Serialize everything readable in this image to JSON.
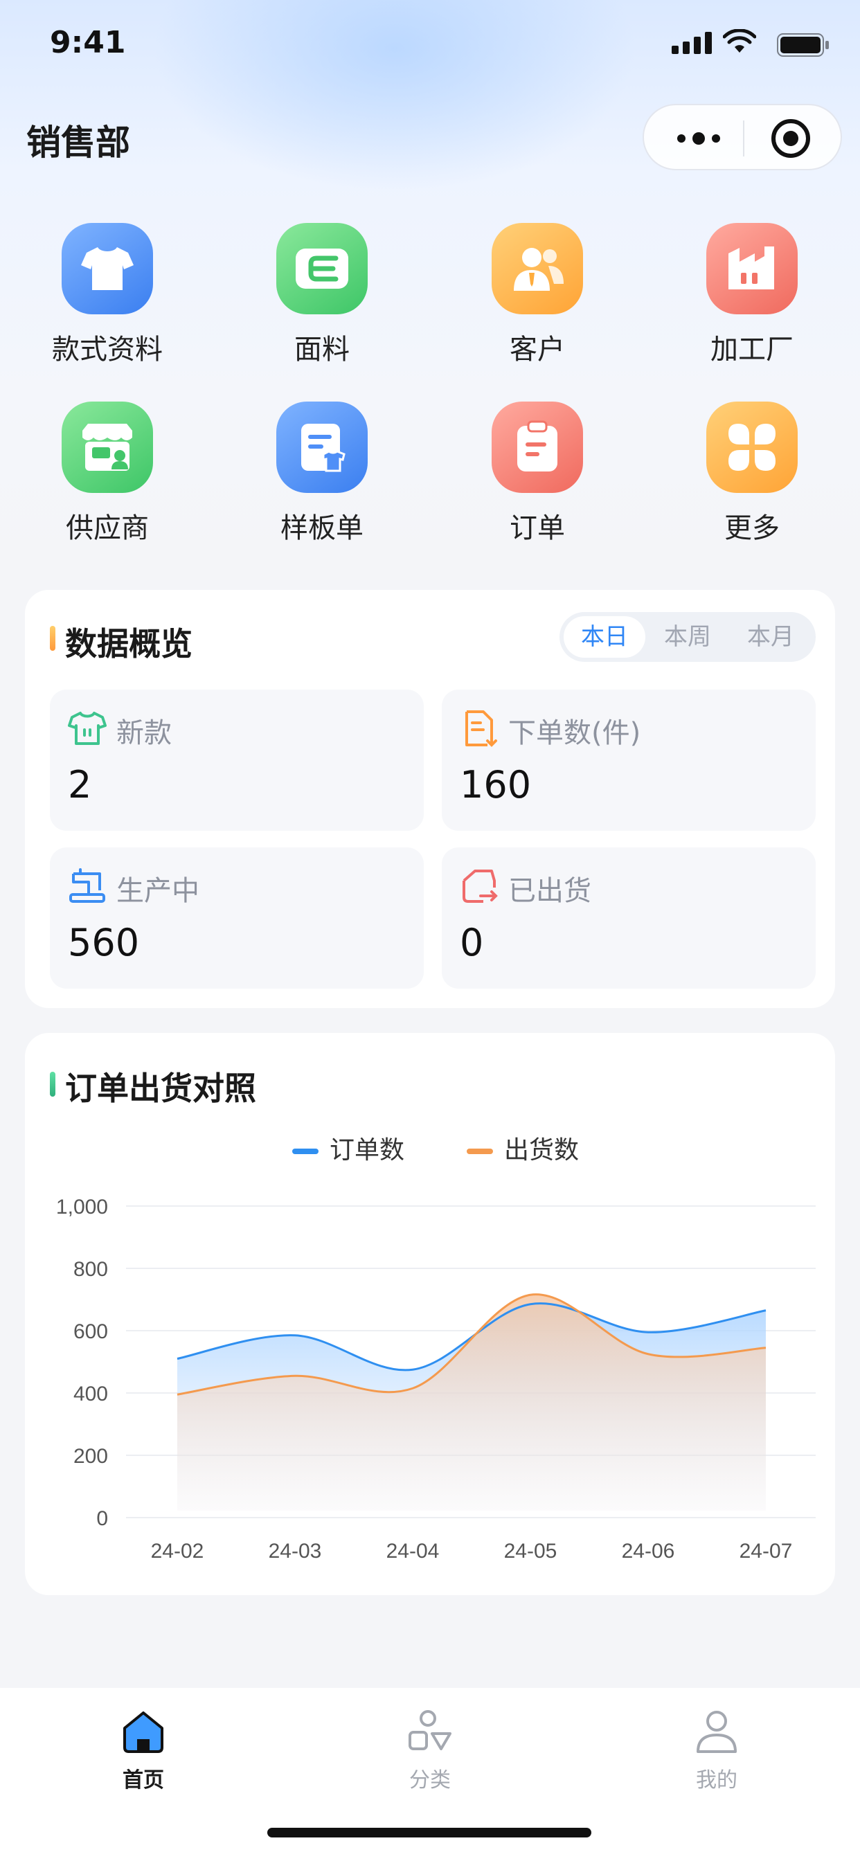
{
  "status_bar": {
    "time": "9:41"
  },
  "header": {
    "title": "销售部"
  },
  "grid": [
    {
      "label": "款式资料",
      "icon": "tshirt-icon",
      "color": "#4f8ff7"
    },
    {
      "label": "面料",
      "icon": "fabric-icon",
      "color": "#4fcf72"
    },
    {
      "label": "客户",
      "icon": "customer-icon",
      "color": "#ffad3d"
    },
    {
      "label": "加工厂",
      "icon": "factory-icon",
      "color": "#f27468"
    },
    {
      "label": "供应商",
      "icon": "supplier-store-icon",
      "color": "#4fcf72"
    },
    {
      "label": "样板单",
      "icon": "sample-sheet-icon",
      "color": "#4f8ff7"
    },
    {
      "label": "订单",
      "icon": "order-clipboard-icon",
      "color": "#f27468"
    },
    {
      "label": "更多",
      "icon": "more-grid-icon",
      "color": "#ffad3d"
    }
  ],
  "overview": {
    "title": "数据概览",
    "tabs": [
      {
        "label": "本日",
        "active": true
      },
      {
        "label": "本周",
        "active": false
      },
      {
        "label": "本月",
        "active": false
      }
    ],
    "stats": [
      {
        "label": "新款",
        "value": "2",
        "icon": "new-style-icon",
        "color": "#3ec48e"
      },
      {
        "label": "下单数(件)",
        "value": "160",
        "icon": "order-doc-icon",
        "color": "#ff9a3c"
      },
      {
        "label": "生产中",
        "value": "560",
        "icon": "sewing-machine-icon",
        "color": "#3b8df2"
      },
      {
        "label": "已出货",
        "value": "0",
        "icon": "shipped-icon",
        "color": "#ef6b6b"
      }
    ]
  },
  "shipment": {
    "title": "订单出货对照"
  },
  "chart_data": {
    "type": "area",
    "x": [
      "24-02",
      "24-03",
      "24-04",
      "24-05",
      "24-06",
      "24-07"
    ],
    "series": [
      {
        "name": "订单数",
        "values": [
          510,
          585,
          475,
          685,
          595,
          665
        ],
        "color": "#2f8ff0"
      },
      {
        "name": "出货数",
        "values": [
          395,
          455,
          415,
          715,
          525,
          545
        ],
        "color": "#f49a4e"
      }
    ],
    "ylim": [
      0,
      1000
    ],
    "yticks": [
      "0",
      "200",
      "400",
      "600",
      "800",
      "1,000"
    ],
    "grid": true,
    "legend": "top-center"
  },
  "tabbar": [
    {
      "label": "首页",
      "icon": "home-icon",
      "active": true
    },
    {
      "label": "分类",
      "icon": "category-icon",
      "active": false
    },
    {
      "label": "我的",
      "icon": "profile-icon",
      "active": false
    }
  ]
}
